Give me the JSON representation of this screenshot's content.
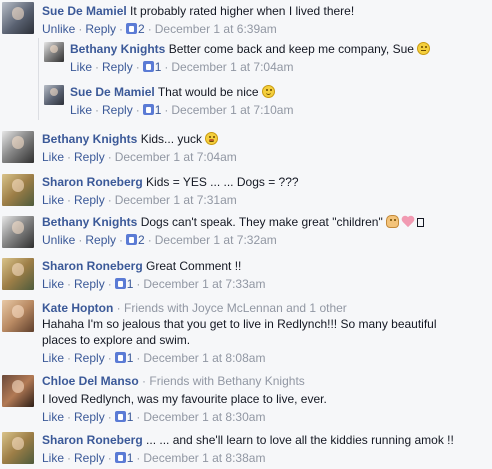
{
  "actions": {
    "like": "Like",
    "unlike": "Unlike",
    "reply": "Reply"
  },
  "comments": [
    {
      "author": "Sue De Mamiel",
      "text": "It probably rated higher when I lived there!",
      "like_action": "Unlike",
      "likes": "2",
      "time": "December 1 at 6:39am",
      "avatar": "sue-avatar"
    },
    {
      "author": "Bethany Knights",
      "text": "Better come back and keep me company, Sue",
      "like_action": "Like",
      "likes": "1",
      "time": "December 1 at 7:04am",
      "avatar": "bethany-avatar",
      "emoji": "expressionless-emoji-icon"
    },
    {
      "author": "Sue De Mamiel",
      "text": "That would be nice",
      "like_action": "Like",
      "likes": "1",
      "time": "December 1 at 7:10am",
      "avatar": "sue-avatar",
      "emoji": "smile-emoji-icon"
    },
    {
      "author": "Bethany Knights",
      "text": "Kids... yuck",
      "like_action": "Like",
      "likes": "",
      "time": "December 1 at 7:04am",
      "avatar": "bethany-avatar",
      "emoji": "grimace-emoji-icon"
    },
    {
      "author": "Sharon Roneberg",
      "text": "Kids = YES ... ... Dogs = ???",
      "like_action": "Like",
      "likes": "",
      "time": "December 1 at 7:31am",
      "avatar": "sharon-avatar"
    },
    {
      "author": "Bethany Knights",
      "text": "Dogs can't speak. They make great \"children\"",
      "like_action": "Unlike",
      "likes": "2",
      "time": "December 1 at 7:32am",
      "avatar": "bethany-avatar",
      "emoji": "person-emoji-icon"
    },
    {
      "author": "Sharon Roneberg",
      "text": "Great Comment !!",
      "like_action": "Like",
      "likes": "1",
      "time": "December 1 at 7:33am",
      "avatar": "sharon-avatar"
    },
    {
      "author": "Kate Hopton",
      "friends": "· Friends with Joyce McLennan and 1 other",
      "text": "Hahaha I'm so jealous that you get to live in Redlynch!!! So many beautiful places to explore and swim.",
      "like_action": "Like",
      "likes": "1",
      "time": "December 1 at 8:08am",
      "avatar": "kate-avatar"
    },
    {
      "author": "Chloe Del Manso",
      "friends": "· Friends with Bethany Knights",
      "text": "I loved Redlynch, was my favourite place to live, ever.",
      "like_action": "Like",
      "likes": "1",
      "time": "December 1 at 8:30am",
      "avatar": "chloe-avatar"
    },
    {
      "author": "Sharon Roneberg",
      "text": "... ... and she'll learn to love all the kiddies running amok !!",
      "like_action": "Like",
      "likes": "1",
      "time": "December 1 at 8:38am",
      "avatar": "sharon-avatar"
    }
  ],
  "separator": "·",
  "colors": {
    "link": "#3b5998",
    "meta": "#9197a3",
    "text": "#141823",
    "background": "#f6f7f9"
  }
}
